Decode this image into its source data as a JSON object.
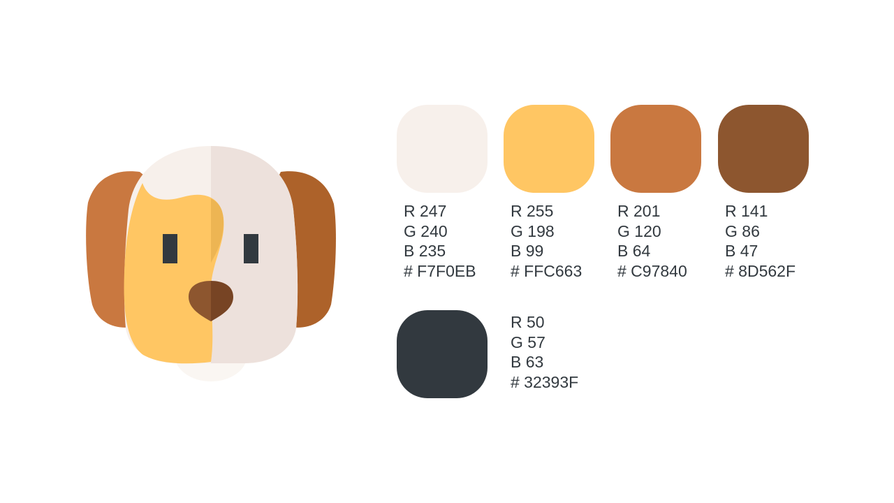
{
  "swatches": [
    {
      "name": "F7F0EB",
      "r": "R 247",
      "g": "G 240",
      "b": "B 235",
      "hex": "# F7F0EB",
      "color": "#F7F0EB"
    },
    {
      "name": "FFC663",
      "r": "R 255",
      "g": "G 198",
      "b": "B 99",
      "hex": "# FFC663",
      "color": "#FFC663"
    },
    {
      "name": "C97840",
      "r": "R 201",
      "g": "G 120",
      "b": "B 64",
      "hex": "# C97840",
      "color": "#C97840"
    },
    {
      "name": "8D562F",
      "r": "R 141",
      "g": "G 86",
      "b": "B 47",
      "hex": "# 8D562F",
      "color": "#8D562F"
    },
    {
      "name": "32393F",
      "r": "R 50",
      "g": "G 57",
      "b": "B 63",
      "hex": "# 32393F",
      "color": "#32393F"
    }
  ],
  "illustration": {
    "icon": "dog-face-icon",
    "colors": {
      "ear_left": "#C97840",
      "ear_right": "#AD622A",
      "face_light": "#F7F0EB",
      "face_shade": "#EDE1DC",
      "patch": "#FFC663",
      "patch_shade": "#EDB553",
      "eyes": "#32393F",
      "nose_left": "#8D562F",
      "nose_right": "#774424"
    }
  }
}
